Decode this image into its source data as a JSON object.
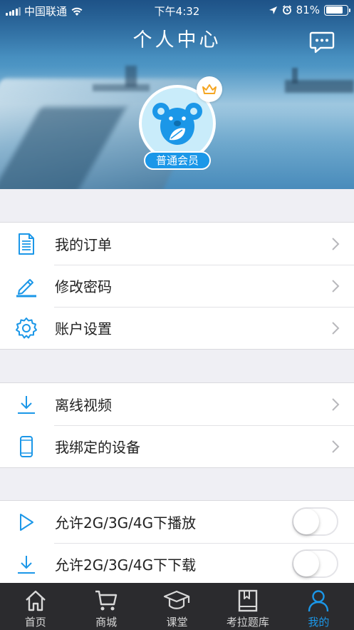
{
  "status_bar": {
    "carrier": "中国联通",
    "time": "下午4:32",
    "battery": "81%",
    "battery_level": 0.81
  },
  "header": {
    "title": "个人中心",
    "member_level": "普通会员"
  },
  "menu_groups": {
    "account": [
      {
        "label": "我的订单",
        "icon": "order-document-icon"
      },
      {
        "label": "修改密码",
        "icon": "edit-pencil-icon"
      },
      {
        "label": "账户设置",
        "icon": "gear-icon"
      }
    ],
    "media": [
      {
        "label": "离线视频",
        "icon": "download-icon"
      },
      {
        "label": "我绑定的设备",
        "icon": "phone-device-icon"
      }
    ],
    "network": [
      {
        "label": "允许2G/3G/4G下播放",
        "icon": "play-icon",
        "enabled": false
      },
      {
        "label": "允许2G/3G/4G下下载",
        "icon": "download-icon",
        "enabled": false
      }
    ]
  },
  "tabbar": {
    "items": [
      {
        "label": "首页",
        "icon": "home-icon",
        "active": false
      },
      {
        "label": "商城",
        "icon": "cart-icon",
        "active": false
      },
      {
        "label": "课堂",
        "icon": "graduation-cap-icon",
        "active": false
      },
      {
        "label": "考拉题库",
        "icon": "book-icon",
        "active": false
      },
      {
        "label": "我的",
        "icon": "person-icon",
        "active": true
      }
    ]
  },
  "colors": {
    "accent": "#1b97e8",
    "tabbar_bg": "#2b2b2e",
    "crown": "#f5a623"
  }
}
